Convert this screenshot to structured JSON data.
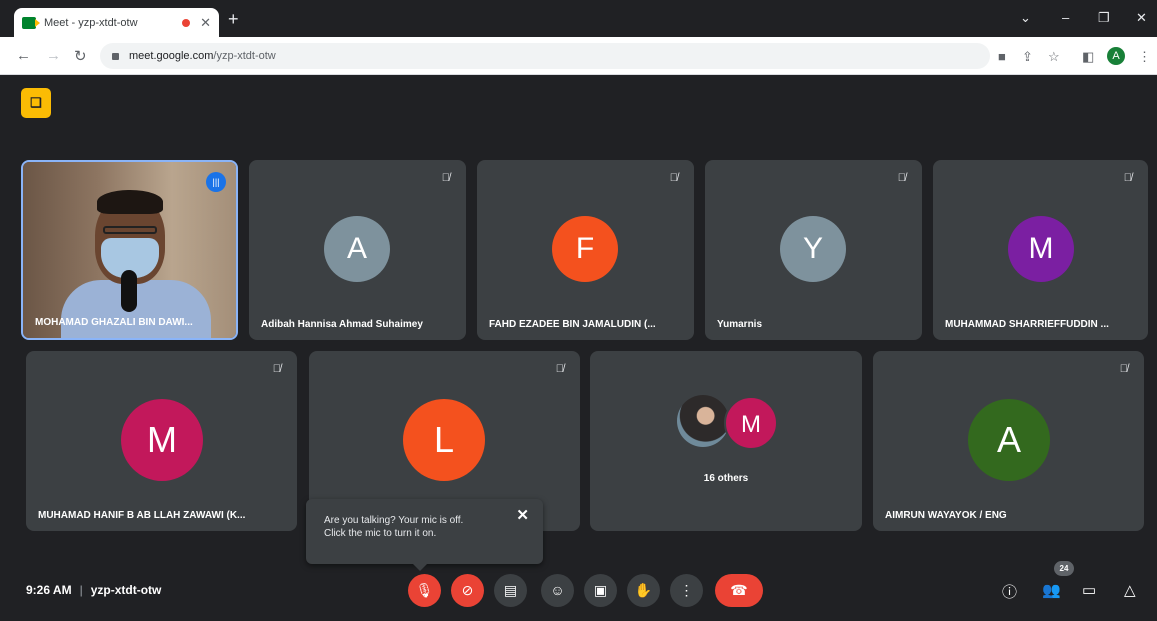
{
  "browser": {
    "tab_title": "Meet - yzp-xtdt-otw",
    "url_host": "meet.google.com",
    "url_path": "/yzp-xtdt-otw",
    "profile_initial": "A"
  },
  "meeting": {
    "time": "9:26 AM",
    "separator": "|",
    "code": "yzp-xtdt-otw",
    "participant_count": "24"
  },
  "participants": [
    {
      "name": "MOHAMAD GHAZALI BIN DAWI...",
      "type": "video"
    },
    {
      "name": "Adibah Hannisa Ahmad Suhaimey",
      "initial": "A",
      "color": "#7e929d"
    },
    {
      "name": "FAHD EZADEE BIN JAMALUDIN (...",
      "initial": "F",
      "color": "#f4511e"
    },
    {
      "name": "Yumarnis",
      "initial": "Y",
      "color": "#7e929d"
    },
    {
      "name": "MUHAMMAD SHARRIEFFUDDIN ...",
      "initial": "M",
      "color": "#7b1fa2"
    },
    {
      "name": "MUHAMAD HANIF B AB LLAH ZAWAWI (K...",
      "initial": "M",
      "color": "#c2185b"
    },
    {
      "name": "",
      "initial": "L",
      "color": "#f4511e"
    },
    {
      "name": "16 others",
      "initial": "M",
      "color": "#c2185b"
    },
    {
      "name": "AIMRUN WAYAYOK / ENG",
      "initial": "A",
      "color": "#33691e"
    }
  ],
  "tooltip": {
    "line1": "Are you talking? Your mic is off.",
    "line2": "Click the mic to turn it on."
  },
  "colors": {
    "background": "#202124",
    "tile": "#3c4043",
    "accent_red": "#ea4335",
    "speaking_blue": "#1a73e8"
  }
}
